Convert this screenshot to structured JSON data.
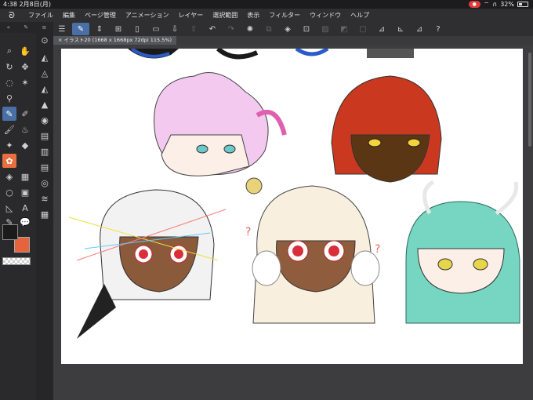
{
  "status": {
    "time": "4:38",
    "date": "2月8日(月)",
    "battery": "32%"
  },
  "menu": {
    "items": [
      "ファイル",
      "編集",
      "ページ管理",
      "アニメーション",
      "レイヤー",
      "選択範囲",
      "表示",
      "フィルター",
      "ウィンドウ",
      "ヘルプ"
    ]
  },
  "document": {
    "tab_label": "イラスト20 (1668 x 1668px 72dpi 115.5%)"
  },
  "colors": {
    "main": "#1b1b1b",
    "sub": "#e5643c",
    "accent": "#4a6fa5"
  },
  "icons": {
    "tools_a": [
      "pen-icon",
      "hand-icon",
      "magnifier-icon",
      "move-icon",
      "lasso-icon",
      "wand-icon",
      "eyedropper-icon",
      "pen-nib-icon",
      "brush-icon",
      "airbrush-icon",
      "decoration-icon",
      "eraser-icon",
      "blend-icon",
      "fill-icon",
      "gradient-icon",
      "figure-icon",
      "frame-icon",
      "ruler-icon",
      "text-icon",
      "balloon-icon",
      "line-icon"
    ],
    "commands": [
      "menu-icon",
      "sketch-icon",
      "chevron-icon",
      "pen-pressure-icon",
      "new-icon",
      "open-icon",
      "save-icon",
      "undo-icon",
      "redo-icon",
      "loading-icon",
      "copy-icon",
      "fill-icon",
      "transform-icon",
      "deselect-icon",
      "invert-icon",
      "crop-icon",
      "ruler-icon",
      "ruler2-icon",
      "ruler3-icon",
      "help-icon"
    ]
  }
}
